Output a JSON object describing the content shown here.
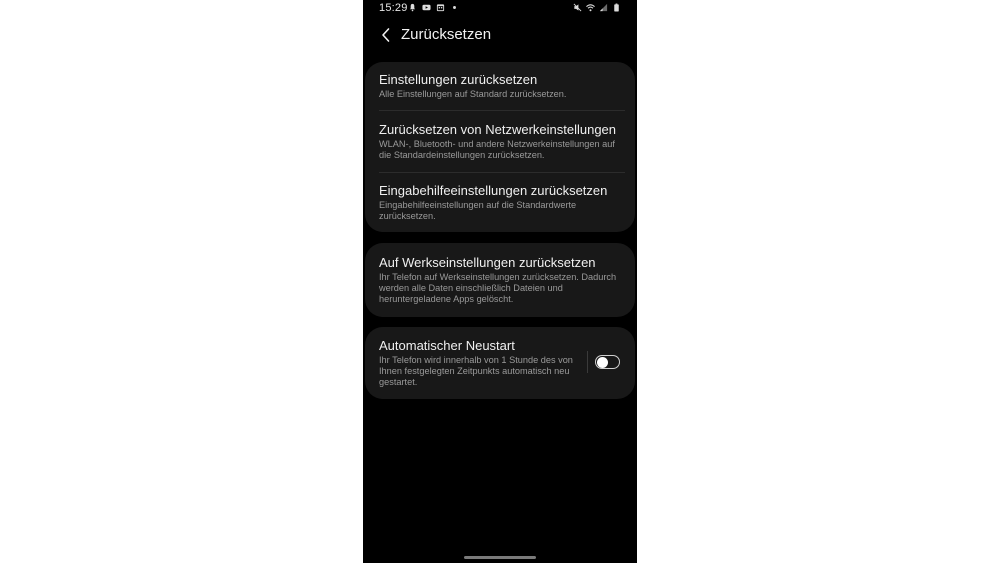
{
  "status_bar": {
    "time": "15:29",
    "left_icons": [
      "mute-notification-icon",
      "youtube-icon",
      "calendar-icon",
      "dot-icon"
    ],
    "right_icons": [
      "mute-icon",
      "wifi-icon",
      "signal-icon",
      "battery-icon"
    ]
  },
  "header": {
    "title": "Zurücksetzen"
  },
  "groups": [
    {
      "items": [
        {
          "title": "Einstellungen zurücksetzen",
          "description": "Alle Einstellungen auf Standard zurücksetzen."
        },
        {
          "title": "Zurücksetzen von Netzwerkeinstellungen",
          "description": "WLAN-, Bluetooth- und andere Netzwerkeinstellungen auf die Standardeinstellungen zurücksetzen."
        },
        {
          "title": "Eingabehilfeeinstellungen zurücksetzen",
          "description": "Eingabehilfeeinstellungen auf die Standardwerte zurücksetzen."
        }
      ]
    },
    {
      "items": [
        {
          "title": "Auf Werkseinstellungen zurücksetzen",
          "description": "Ihr Telefon auf Werkseinstellungen zurücksetzen. Dadurch werden alle Daten einschließlich Dateien und heruntergeladene Apps gelöscht."
        }
      ]
    },
    {
      "items": [
        {
          "title": "Automatischer Neustart",
          "description": "Ihr Telefon wird innerhalb von 1 Stunde des von Ihnen festgelegten Zeitpunkts automatisch neu gestartet.",
          "toggle": {
            "on": false
          }
        }
      ]
    }
  ],
  "colors": {
    "background": "#000000",
    "card": "#181818",
    "title_text": "#f0f0f0",
    "secondary_text": "#9a9a9a"
  }
}
